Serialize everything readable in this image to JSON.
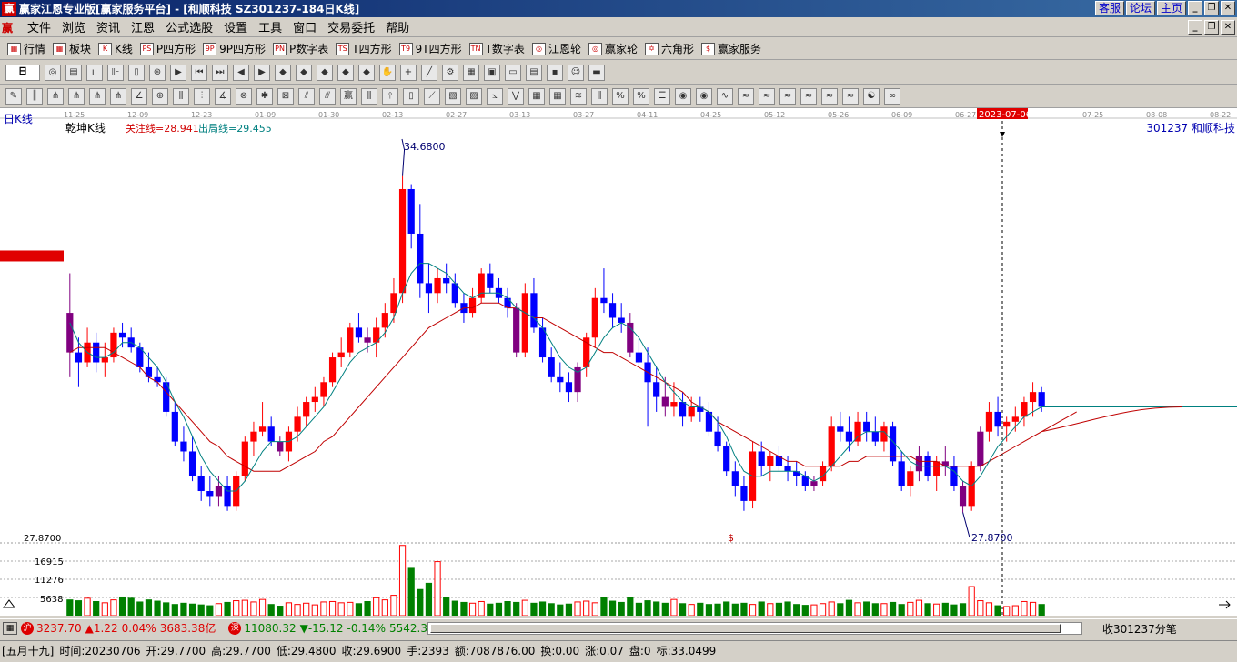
{
  "window": {
    "logo": "赢",
    "title": "赢家江恩专业版[赢家服务平台] - [和顺科技   SZ301237-184日K线]",
    "right_links": [
      "客服",
      "论坛",
      "主页"
    ],
    "controls": [
      "_",
      "❐",
      "✕"
    ]
  },
  "menu": {
    "logo": "赢",
    "items": [
      "文件",
      "浏览",
      "资讯",
      "江恩",
      "公式选股",
      "设置",
      "工具",
      "窗口",
      "交易委托",
      "帮助"
    ]
  },
  "toolbar1": {
    "items": [
      {
        "icon": "▦",
        "label": "行情"
      },
      {
        "icon": "▦",
        "label": "板块"
      },
      {
        "icon": "K",
        "label": "K线"
      },
      {
        "icon": "PS",
        "label": "P四方形"
      },
      {
        "icon": "9P",
        "label": "9P四方形"
      },
      {
        "icon": "PN",
        "label": "P数字表"
      },
      {
        "icon": "TS",
        "label": "T四方形"
      },
      {
        "icon": "T9",
        "label": "9T四方形"
      },
      {
        "icon": "TN",
        "label": "T数字表"
      },
      {
        "icon": "◎",
        "label": "江恩轮"
      },
      {
        "icon": "◎",
        "label": "赢家轮"
      },
      {
        "icon": "✡",
        "label": "六角形"
      },
      {
        "icon": "$",
        "label": "赢家服务"
      }
    ]
  },
  "toolbar2": {
    "period": "日"
  },
  "chart_data": {
    "type": "candlestick",
    "title": "日K线",
    "indicator_name": "乾坤K线",
    "legend": [
      {
        "name": "关注线=28.941",
        "color": "#d00000"
      },
      {
        "name": "出局线=29.455",
        "color": "#008080"
      }
    ],
    "stock_label": "301237  和顺科技",
    "date_ticks": [
      "11-25",
      "12-09",
      "12-23",
      "01-09",
      "01-30",
      "02-13",
      "02-27",
      "03-13",
      "03-27",
      "04-11",
      "04-25",
      "05-12",
      "05-26",
      "06-09",
      "06-27",
      "2023-07-06",
      "07-25",
      "08-08",
      "08-22"
    ],
    "highlight_date": "2023-07-06",
    "cursor_price": "33.0499",
    "high_label": "34.6800",
    "low_label": "27.8700",
    "left_price_label": "27.8700",
    "volume_ticks": [
      "16915",
      "11276",
      "5638"
    ],
    "ylim": [
      27.4,
      35.3
    ],
    "candles": [
      [
        31.9,
        32.7,
        30.6,
        31.1
      ],
      [
        31.1,
        31.4,
        30.4,
        30.9
      ],
      [
        30.9,
        31.6,
        30.8,
        31.3
      ],
      [
        31.3,
        31.5,
        30.7,
        30.9
      ],
      [
        30.9,
        31.3,
        30.6,
        31.0
      ],
      [
        31.0,
        31.6,
        30.9,
        31.5
      ],
      [
        31.5,
        31.7,
        31.2,
        31.4
      ],
      [
        31.4,
        31.6,
        31.1,
        31.2
      ],
      [
        31.2,
        31.3,
        30.7,
        30.8
      ],
      [
        30.8,
        31.1,
        30.5,
        30.6
      ],
      [
        30.6,
        30.8,
        30.4,
        30.5
      ],
      [
        30.5,
        30.6,
        29.8,
        29.9
      ],
      [
        29.9,
        30.1,
        29.2,
        29.3
      ],
      [
        29.3,
        29.6,
        28.9,
        29.1
      ],
      [
        29.1,
        29.4,
        28.5,
        28.6
      ],
      [
        28.6,
        28.8,
        28.1,
        28.3
      ],
      [
        28.3,
        28.6,
        28.0,
        28.2
      ],
      [
        28.2,
        28.6,
        28.0,
        28.4
      ],
      [
        28.4,
        28.6,
        27.9,
        28.0
      ],
      [
        28.0,
        28.7,
        27.9,
        28.6
      ],
      [
        28.6,
        29.4,
        28.5,
        29.3
      ],
      [
        29.3,
        29.7,
        29.0,
        29.5
      ],
      [
        29.5,
        30.1,
        29.4,
        29.6
      ],
      [
        29.6,
        29.8,
        29.2,
        29.3
      ],
      [
        29.3,
        29.4,
        29.0,
        29.1
      ],
      [
        29.1,
        29.6,
        28.9,
        29.5
      ],
      [
        29.5,
        30.0,
        29.3,
        29.8
      ],
      [
        29.8,
        30.2,
        29.6,
        30.1
      ],
      [
        30.1,
        30.4,
        29.9,
        30.2
      ],
      [
        30.2,
        30.6,
        30.0,
        30.5
      ],
      [
        30.5,
        31.1,
        30.4,
        31.0
      ],
      [
        31.0,
        31.4,
        30.8,
        31.1
      ],
      [
        31.1,
        31.7,
        31.0,
        31.6
      ],
      [
        31.6,
        31.9,
        31.3,
        31.4
      ],
      [
        31.4,
        31.6,
        31.1,
        31.3
      ],
      [
        31.3,
        31.8,
        31.0,
        31.6
      ],
      [
        31.6,
        32.1,
        31.4,
        31.9
      ],
      [
        31.9,
        32.6,
        31.7,
        32.3
      ],
      [
        32.3,
        34.68,
        32.1,
        34.4
      ],
      [
        34.4,
        34.5,
        33.2,
        33.5
      ],
      [
        33.5,
        34.1,
        32.2,
        32.5
      ],
      [
        32.5,
        32.9,
        31.9,
        32.3
      ],
      [
        32.3,
        32.8,
        32.1,
        32.6
      ],
      [
        32.6,
        32.9,
        32.3,
        32.5
      ],
      [
        32.5,
        32.7,
        32.0,
        32.1
      ],
      [
        32.1,
        32.3,
        31.7,
        31.9
      ],
      [
        31.9,
        32.4,
        31.8,
        32.2
      ],
      [
        32.2,
        32.8,
        32.1,
        32.7
      ],
      [
        32.7,
        32.9,
        32.3,
        32.4
      ],
      [
        32.4,
        32.6,
        32.1,
        32.2
      ],
      [
        32.2,
        32.4,
        31.8,
        32.0
      ],
      [
        32.0,
        32.1,
        31.0,
        31.1
      ],
      [
        31.1,
        32.5,
        31.0,
        32.3
      ],
      [
        32.3,
        32.6,
        31.5,
        31.6
      ],
      [
        31.6,
        31.8,
        30.9,
        31.0
      ],
      [
        31.0,
        31.2,
        30.5,
        30.6
      ],
      [
        30.6,
        30.9,
        30.3,
        30.5
      ],
      [
        30.5,
        30.7,
        30.1,
        30.3
      ],
      [
        30.3,
        30.9,
        30.1,
        30.8
      ],
      [
        30.8,
        31.5,
        30.6,
        31.4
      ],
      [
        31.4,
        32.4,
        31.2,
        32.2
      ],
      [
        32.2,
        32.8,
        31.9,
        32.1
      ],
      [
        32.1,
        32.3,
        31.6,
        31.8
      ],
      [
        31.8,
        32.1,
        31.5,
        31.7
      ],
      [
        31.7,
        31.9,
        31.0,
        31.1
      ],
      [
        31.1,
        31.4,
        30.8,
        30.9
      ],
      [
        30.9,
        31.2,
        29.6,
        30.5
      ],
      [
        30.5,
        30.8,
        29.9,
        30.2
      ],
      [
        30.2,
        30.6,
        29.8,
        30.0
      ],
      [
        30.0,
        30.5,
        29.8,
        30.1
      ],
      [
        30.1,
        30.3,
        29.6,
        29.8
      ],
      [
        29.8,
        30.2,
        29.7,
        30.0
      ],
      [
        30.0,
        30.2,
        29.7,
        29.9
      ],
      [
        29.9,
        30.1,
        29.4,
        29.5
      ],
      [
        29.5,
        29.8,
        29.1,
        29.2
      ],
      [
        29.2,
        29.3,
        28.6,
        28.7
      ],
      [
        28.7,
        28.9,
        28.2,
        28.4
      ],
      [
        28.4,
        28.6,
        27.9,
        28.1
      ],
      [
        28.1,
        29.3,
        27.95,
        29.1
      ],
      [
        29.1,
        29.3,
        28.6,
        28.8
      ],
      [
        28.8,
        29.1,
        28.5,
        29.0
      ],
      [
        29.0,
        29.2,
        28.7,
        28.8
      ],
      [
        28.8,
        29.0,
        28.5,
        28.7
      ],
      [
        28.7,
        28.9,
        28.4,
        28.6
      ],
      [
        28.6,
        28.7,
        28.3,
        28.4
      ],
      [
        28.4,
        28.6,
        28.3,
        28.5
      ],
      [
        28.5,
        28.9,
        28.4,
        28.8
      ],
      [
        28.8,
        29.8,
        28.7,
        29.6
      ],
      [
        29.6,
        29.9,
        29.3,
        29.5
      ],
      [
        29.5,
        29.8,
        29.1,
        29.3
      ],
      [
        29.3,
        29.9,
        29.2,
        29.7
      ],
      [
        29.7,
        29.9,
        29.3,
        29.5
      ],
      [
        29.5,
        29.8,
        29.2,
        29.3
      ],
      [
        29.3,
        29.7,
        29.1,
        29.6
      ],
      [
        29.6,
        29.7,
        28.8,
        28.9
      ],
      [
        28.9,
        29.1,
        28.3,
        28.4
      ],
      [
        28.4,
        28.8,
        28.2,
        28.7
      ],
      [
        28.7,
        29.2,
        28.5,
        29.0
      ],
      [
        29.0,
        29.1,
        28.5,
        28.6
      ],
      [
        28.6,
        29.0,
        28.3,
        28.9
      ],
      [
        28.9,
        29.2,
        28.6,
        28.8
      ],
      [
        28.8,
        29.0,
        28.3,
        28.4
      ],
      [
        28.4,
        28.5,
        27.87,
        28.0
      ],
      [
        28.0,
        28.9,
        27.9,
        28.8
      ],
      [
        28.8,
        29.6,
        28.7,
        29.5
      ],
      [
        29.5,
        30.1,
        29.3,
        29.9
      ],
      [
        29.9,
        30.2,
        29.4,
        29.6
      ],
      [
        29.6,
        29.8,
        29.3,
        29.7
      ],
      [
        29.7,
        30.0,
        29.5,
        29.8
      ],
      [
        29.8,
        30.2,
        29.6,
        30.1
      ],
      [
        30.1,
        30.5,
        29.8,
        30.3
      ],
      [
        30.3,
        30.4,
        29.9,
        30.0
      ]
    ],
    "ma_fast": [
      31.7,
      31.3,
      31.1,
      31.0,
      31.0,
      31.1,
      31.3,
      31.3,
      31.2,
      31.0,
      30.8,
      30.5,
      30.1,
      29.8,
      29.4,
      29.0,
      28.7,
      28.5,
      28.3,
      28.3,
      28.5,
      28.8,
      29.1,
      29.3,
      29.3,
      29.3,
      29.4,
      29.6,
      29.8,
      30.0,
      30.3,
      30.6,
      30.9,
      31.1,
      31.2,
      31.3,
      31.5,
      31.8,
      32.3,
      32.7,
      32.9,
      32.9,
      32.8,
      32.7,
      32.5,
      32.3,
      32.2,
      32.3,
      32.3,
      32.3,
      32.2,
      32.0,
      31.9,
      31.8,
      31.6,
      31.3,
      31.0,
      30.8,
      30.7,
      30.8,
      31.1,
      31.4,
      31.6,
      31.7,
      31.6,
      31.4,
      31.1,
      30.8,
      30.5,
      30.3,
      30.1,
      30.0,
      30.0,
      29.9,
      29.7,
      29.4,
      29.0,
      28.7,
      28.6,
      28.6,
      28.7,
      28.7,
      28.7,
      28.7,
      28.6,
      28.5,
      28.6,
      28.8,
      29.0,
      29.2,
      29.4,
      29.5,
      29.5,
      29.5,
      29.3,
      29.1,
      28.9,
      28.8,
      28.8,
      28.8,
      28.8,
      28.7,
      28.5,
      28.4,
      28.6,
      28.9,
      29.2,
      29.4,
      29.6,
      29.8,
      29.9,
      30.0,
      30.0,
      30.0,
      30.0,
      30.0
    ],
    "ma_slow": [
      31.1,
      31.2,
      31.2,
      31.2,
      31.2,
      31.1,
      31.0,
      30.9,
      30.8,
      30.6,
      30.5,
      30.3,
      30.1,
      29.9,
      29.7,
      29.5,
      29.3,
      29.2,
      29.0,
      28.9,
      28.8,
      28.7,
      28.7,
      28.7,
      28.7,
      28.8,
      28.9,
      29.0,
      29.1,
      29.3,
      29.4,
      29.6,
      29.8,
      30.0,
      30.2,
      30.4,
      30.6,
      30.8,
      31.0,
      31.2,
      31.4,
      31.6,
      31.7,
      31.8,
      31.9,
      32.0,
      32.0,
      32.1,
      32.1,
      32.1,
      32.0,
      32.0,
      31.9,
      31.8,
      31.8,
      31.7,
      31.6,
      31.5,
      31.4,
      31.3,
      31.2,
      31.1,
      31.1,
      31.0,
      30.9,
      30.8,
      30.7,
      30.6,
      30.5,
      30.4,
      30.3,
      30.1,
      30.0,
      29.9,
      29.7,
      29.6,
      29.5,
      29.4,
      29.3,
      29.2,
      29.1,
      29.0,
      28.9,
      28.9,
      28.8,
      28.8,
      28.8,
      28.8,
      28.8,
      28.9,
      28.9,
      29.0,
      29.0,
      29.0,
      29.0,
      29.0,
      29.0,
      28.9,
      28.9,
      28.9,
      28.8,
      28.8,
      28.8,
      28.8,
      28.8,
      28.9,
      29.0,
      29.1,
      29.2,
      29.3,
      29.4,
      29.5,
      29.6,
      29.7,
      29.8,
      29.9
    ],
    "volumes": [
      3900,
      3700,
      4200,
      3500,
      3100,
      3800,
      4600,
      4300,
      3400,
      3900,
      3600,
      3200,
      2800,
      3100,
      2900,
      2700,
      2500,
      2900,
      3300,
      3600,
      3700,
      3300,
      3900,
      2800,
      2400,
      3100,
      2700,
      3000,
      2600,
      3300,
      3400,
      3100,
      3200,
      3000,
      3500,
      4300,
      3800,
      4900,
      16900,
      11500,
      6400,
      7900,
      13000,
      4500,
      3600,
      3300,
      3000,
      3400,
      2900,
      3100,
      3500,
      3300,
      3700,
      3100,
      3400,
      3000,
      2700,
      2900,
      3300,
      3500,
      3100,
      4400,
      3600,
      3300,
      4400,
      3100,
      3700,
      3400,
      3100,
      3900,
      3000,
      2700,
      3100,
      2800,
      2900,
      3400,
      2900,
      3100,
      2700,
      3400,
      2900,
      3100,
      3400,
      2800,
      2600,
      2600,
      2900,
      3300,
      3000,
      3800,
      3100,
      3400,
      3000,
      2900,
      3300,
      2800,
      3200,
      3700,
      3000,
      2800,
      3100,
      2700,
      3000,
      7000,
      3600,
      3100,
      2500,
      2200,
      2400,
      3400,
      3200,
      2800
    ]
  },
  "status": {
    "sh_label": "沪",
    "sh_index": "3237.70",
    "sh_change": "▲1.22",
    "sh_pct": "0.04%",
    "sh_amount": "3683.38亿",
    "sz_label": "深",
    "sz_index": "11080.32",
    "sz_change": "▼-15.12",
    "sz_pct": "-0.14%",
    "sz_amount": "5542.3",
    "right_text": "收301237分笔"
  },
  "info": {
    "lunar": "[五月十九]",
    "date": "时间:20230706",
    "open": "开:29.7700",
    "high": "高:29.7700",
    "low": "低:29.4800",
    "close": "收:29.6900",
    "hand": "手:2393",
    "amount": "额:7087876.00",
    "turnover": "换:0.00",
    "up": "涨:0.07",
    "pan": "盘:0",
    "mark": "标:33.0499"
  }
}
